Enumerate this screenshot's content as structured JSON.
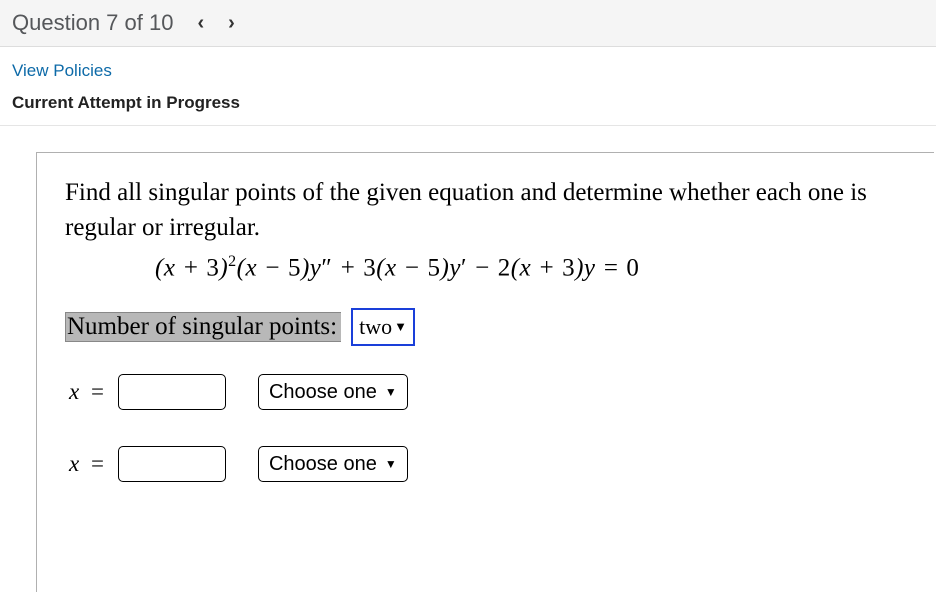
{
  "header": {
    "question_label": "Question 7 of 10"
  },
  "links": {
    "view_policies": "View Policies"
  },
  "status": {
    "attempt": "Current Attempt in Progress"
  },
  "question": {
    "prompt": "Find all singular points of the given equation and determine whether each one is regular or irregular.",
    "equation_display": "(x + 3)²(x − 5)y″ + 3(x − 5)y′ − 2(x + 3)y = 0"
  },
  "singular": {
    "label": "Number of singular points:",
    "selected": "two"
  },
  "points": [
    {
      "var_label": "x",
      "value": "",
      "choice": "Choose one"
    },
    {
      "var_label": "x",
      "value": "",
      "choice": "Choose one"
    }
  ]
}
